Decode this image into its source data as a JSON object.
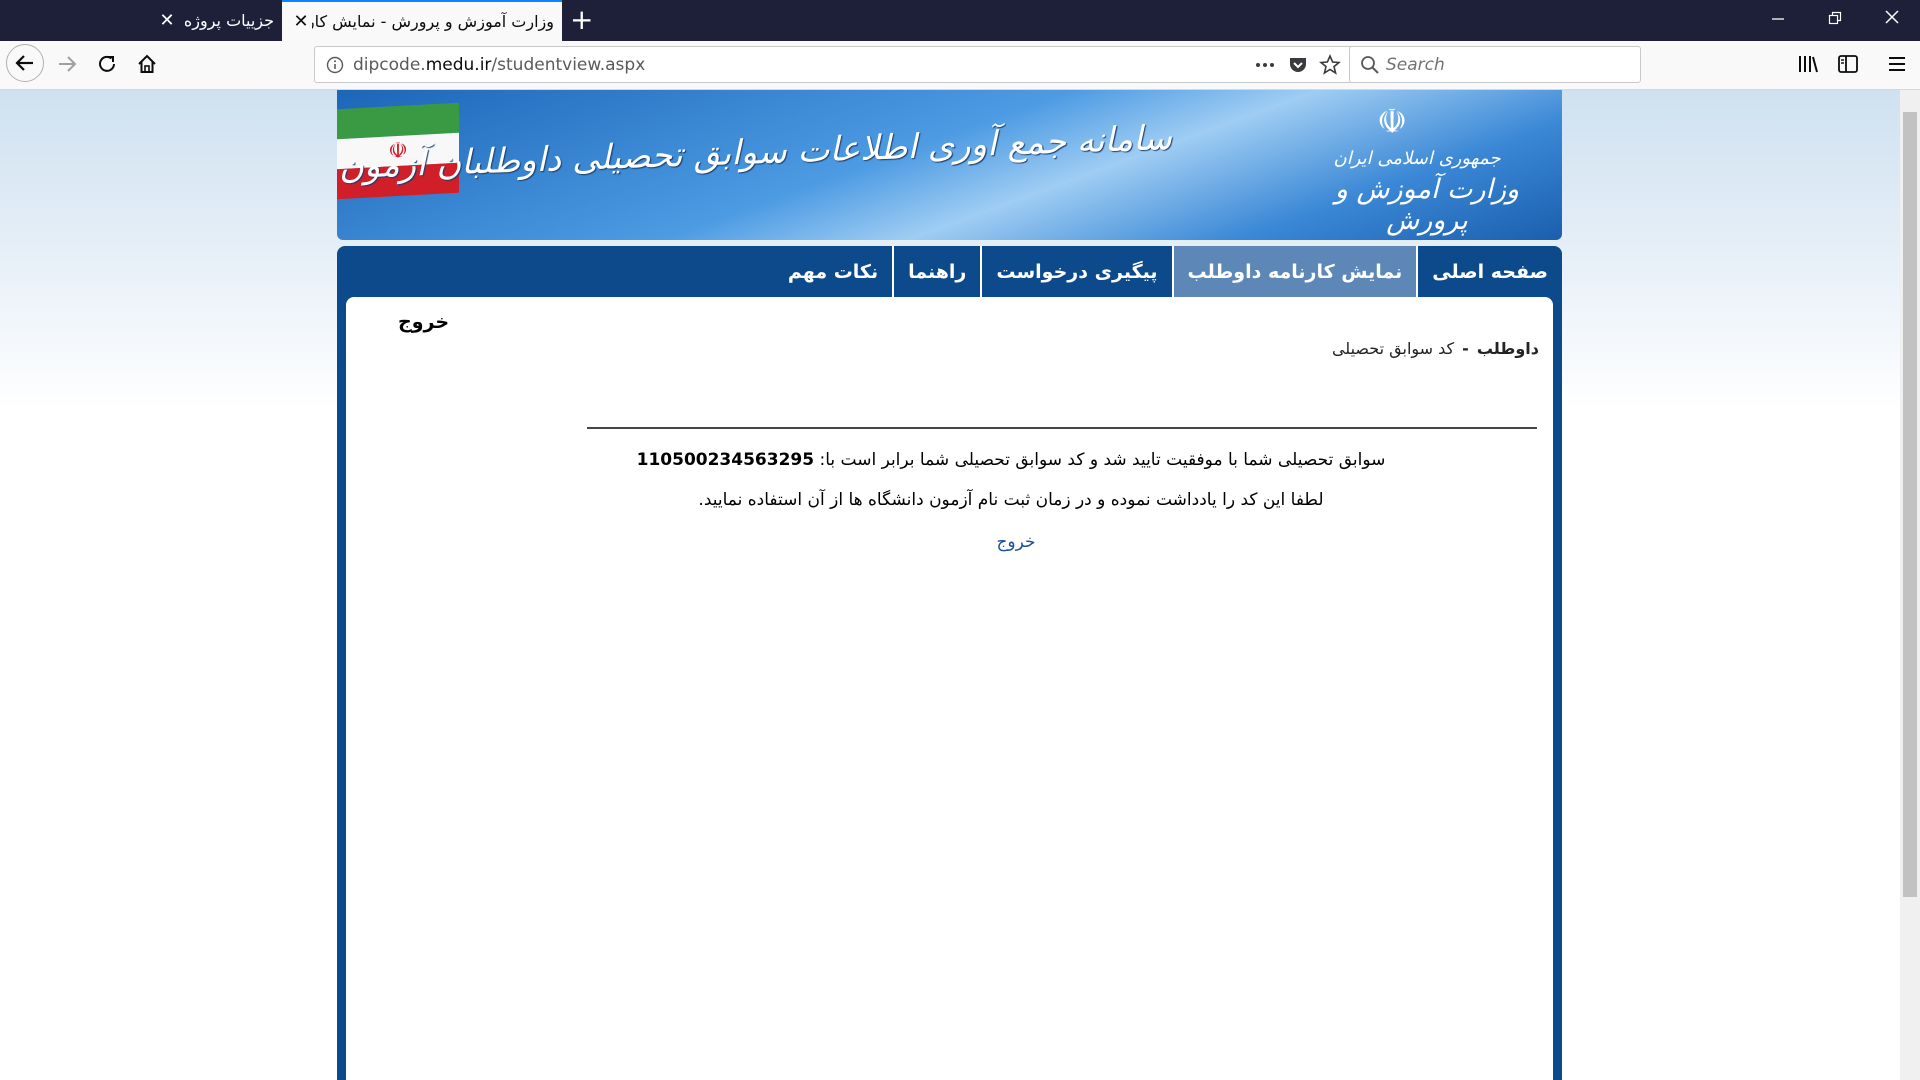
{
  "browser": {
    "tabs": [
      {
        "title": "جزییات پروژه -",
        "close_glyph": "✕"
      },
      {
        "title": "وزارت آموزش و پرورش - نمایش کارنامه",
        "close_glyph": "✕"
      }
    ],
    "new_tab_glyph": "+",
    "url_prefix": "dipcode.",
    "url_domain": "medu.ir",
    "url_path": "/studentview.aspx",
    "search_placeholder": "Search"
  },
  "banner": {
    "system_title": "سامانه جمع آوری اطلاعات سوابق تحصیلی داوطلبان آزمون سراسری ورود به دانشگاه ها",
    "republic": "جمهوری اسلامی ایران",
    "ministry": "وزارت آموزش و پرورش"
  },
  "menu": {
    "items": [
      {
        "label": "صفحه اصلی"
      },
      {
        "label": "نمایش کارنامه داوطلب"
      },
      {
        "label": "پیگیری درخواست"
      },
      {
        "label": "راهنما"
      },
      {
        "label": "نکات مهم"
      }
    ]
  },
  "content": {
    "logout_top": "خروج",
    "breadcrumb_1": "داوطلب",
    "breadcrumb_sep": "-",
    "breadcrumb_2": "کد سوابق تحصیلی",
    "message_text": "سوابق تحصیلی شما با موفقیت تایید شد و کد سوابق تحصیلی شما برابر است با: ",
    "code": "110500234563295",
    "note": "لطفا این کد را یادداشت نموده و در زمان ثبت نام آزمون دانشگاه ها از آن استفاده نمایید.",
    "logout_link": "خروج"
  },
  "colors": {
    "menu_bg": "#0c4a8c",
    "menu_active": "#5d87b7",
    "link": "#1a4f9a",
    "tab_accent": "#0a84ff"
  }
}
